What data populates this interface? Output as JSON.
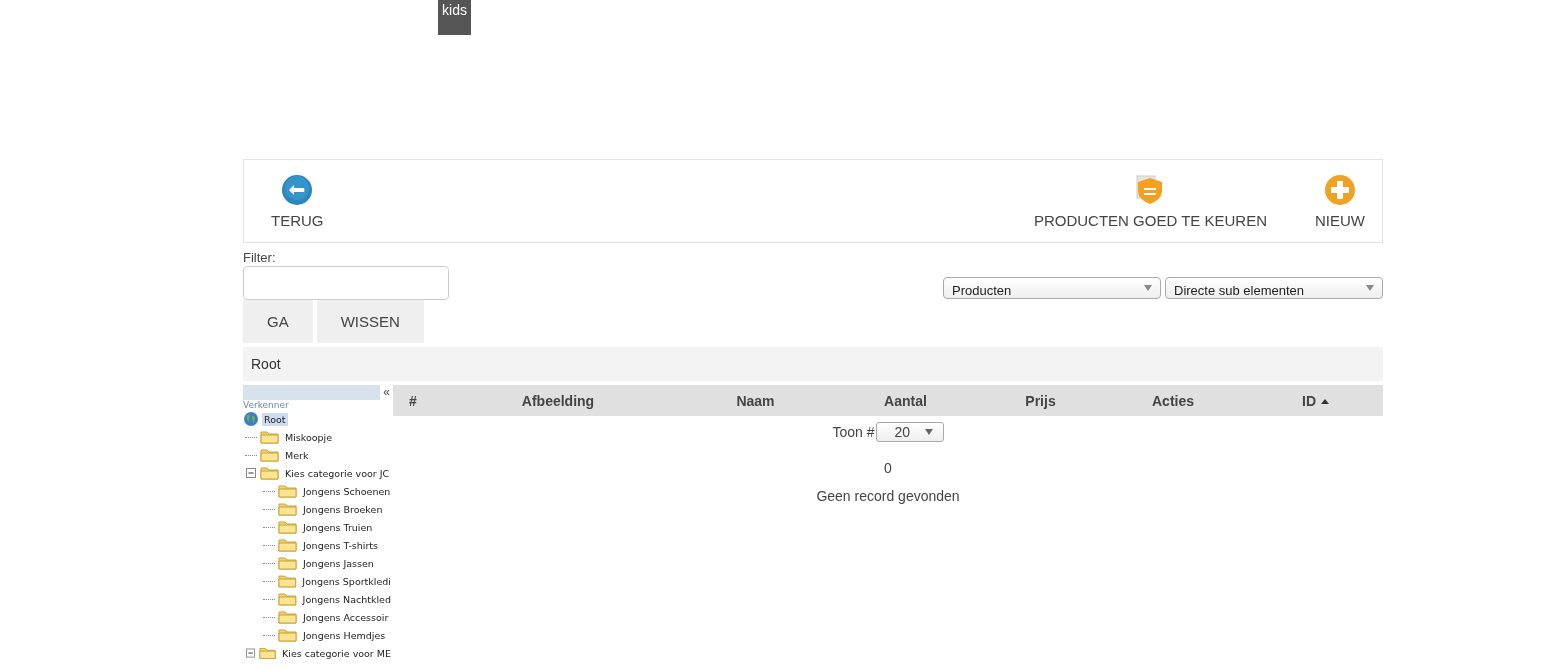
{
  "logo": {
    "text": "kids"
  },
  "toolbar": {
    "buttons": [
      {
        "label": "TERUG",
        "kind": "back"
      },
      {
        "label": "PRODUCTEN GOED TE KEUREN",
        "kind": "approve"
      },
      {
        "label": "NIEUW",
        "kind": "new"
      }
    ]
  },
  "filter": {
    "label": "Filter:",
    "buttons": [
      "GA",
      "WISSEN"
    ]
  },
  "selects": [
    {
      "value": "Producten"
    },
    {
      "value": "Directe sub elementen"
    }
  ],
  "breadcrumb": "Root",
  "explorer": {
    "title": "Verkenner",
    "collapse": "«",
    "tree": [
      {
        "label": "Root",
        "kind": "root",
        "selected": true,
        "children": [
          {
            "label": "Miskoopje",
            "kind": "folder",
            "selected": false,
            "expanded": false
          },
          {
            "label": "Merk",
            "kind": "folder",
            "selected": false,
            "expanded": false
          },
          {
            "label": "Kies categorie voor JC",
            "kind": "folder",
            "selected": false,
            "expanded": true,
            "children": [
              {
                "label": "Jongens Schoenen",
                "kind": "folder",
                "selected": false,
                "expanded": false
              },
              {
                "label": "Jongens Broeken",
                "kind": "folder",
                "selected": false,
                "expanded": false
              },
              {
                "label": "Jongens Truien",
                "kind": "folder",
                "selected": false,
                "expanded": false
              },
              {
                "label": "Jongens T-shirts",
                "kind": "folder",
                "selected": false,
                "expanded": false
              },
              {
                "label": "Jongens Jassen",
                "kind": "folder",
                "selected": false,
                "expanded": false
              },
              {
                "label": "Jongens Sportkledi",
                "kind": "folder",
                "selected": false,
                "expanded": false
              },
              {
                "label": "Jongens Nachtkled",
                "kind": "folder",
                "selected": false,
                "expanded": false
              },
              {
                "label": "Jongens Accessoir",
                "kind": "folder",
                "selected": false,
                "expanded": false
              },
              {
                "label": "Jongens Hemdjes",
                "kind": "folder",
                "selected": false,
                "expanded": false
              }
            ]
          },
          {
            "label": "Kies categorie voor ME",
            "kind": "folder",
            "selected": false,
            "expanded": true
          }
        ]
      }
    ]
  },
  "table": {
    "columns": [
      {
        "label": "#",
        "sorted": false
      },
      {
        "label": "Afbeelding",
        "sorted": false
      },
      {
        "label": "Naam",
        "sorted": false
      },
      {
        "label": "Aantal",
        "sorted": false
      },
      {
        "label": "Prijs",
        "sorted": false
      },
      {
        "label": "Acties",
        "sorted": false
      },
      {
        "label": "ID",
        "sorted": true
      }
    ],
    "page_size_label": "Toon #",
    "page_size": "20",
    "count": "0",
    "empty": "Geen record gevonden"
  }
}
